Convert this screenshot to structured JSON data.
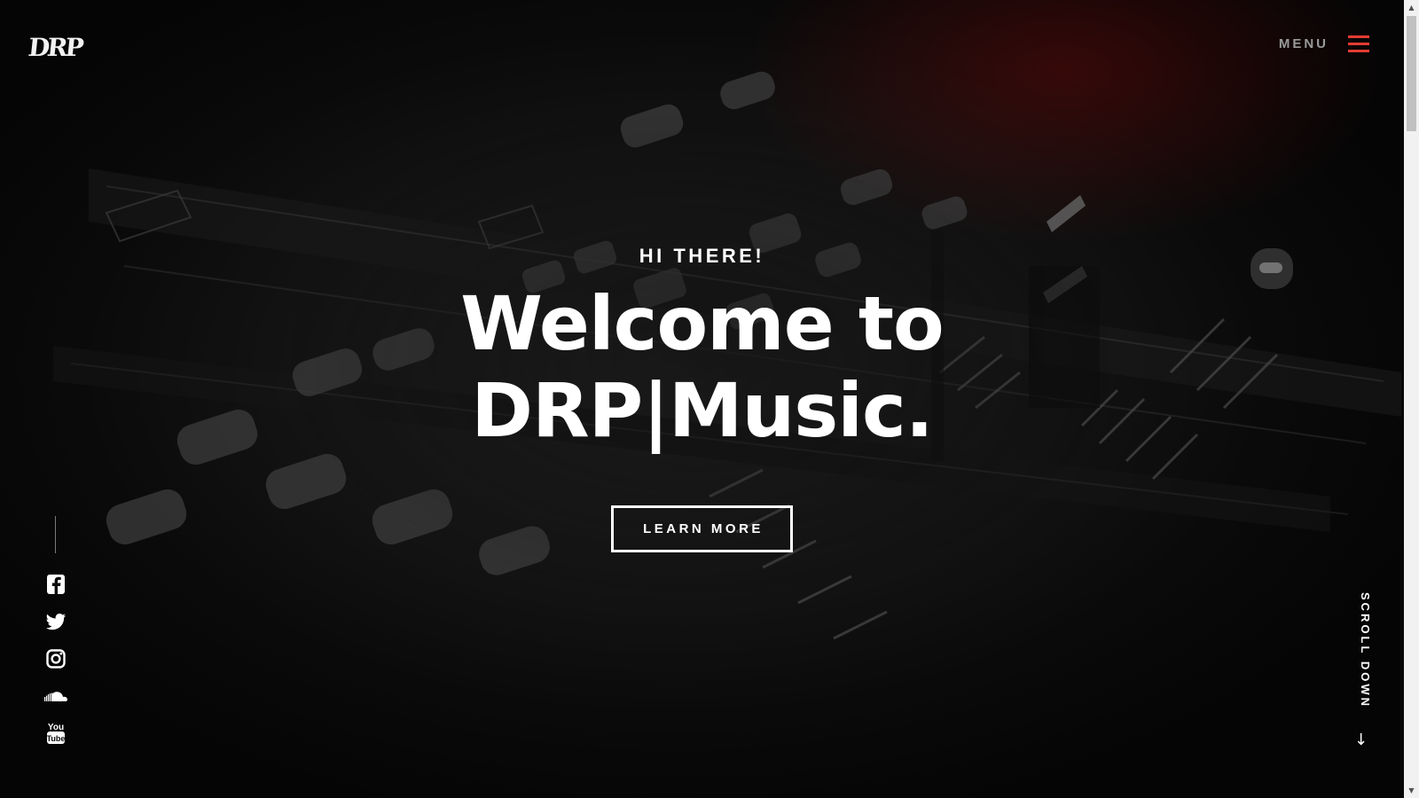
{
  "header": {
    "logo_text": "DRP",
    "menu_label": "MENU",
    "menu_icon": "hamburger-icon",
    "accent_color": "#e23c32"
  },
  "hero": {
    "eyebrow": "HI THERE!",
    "headline_line1": "Welcome to",
    "headline_line2": "DRP|Music.",
    "cta_label": "LEARN MORE",
    "background": "dj-mixer-photo"
  },
  "social": {
    "icons": [
      "facebook-icon",
      "twitter-icon",
      "instagram-icon",
      "soundcloud-icon",
      "youtube-icon"
    ],
    "youtube_you": "You",
    "youtube_tube": "Tube"
  },
  "scroll": {
    "label": "SCROLL DOWN",
    "arrow": "↓"
  },
  "scrollbar": {
    "up": "▲",
    "down": "▼"
  }
}
